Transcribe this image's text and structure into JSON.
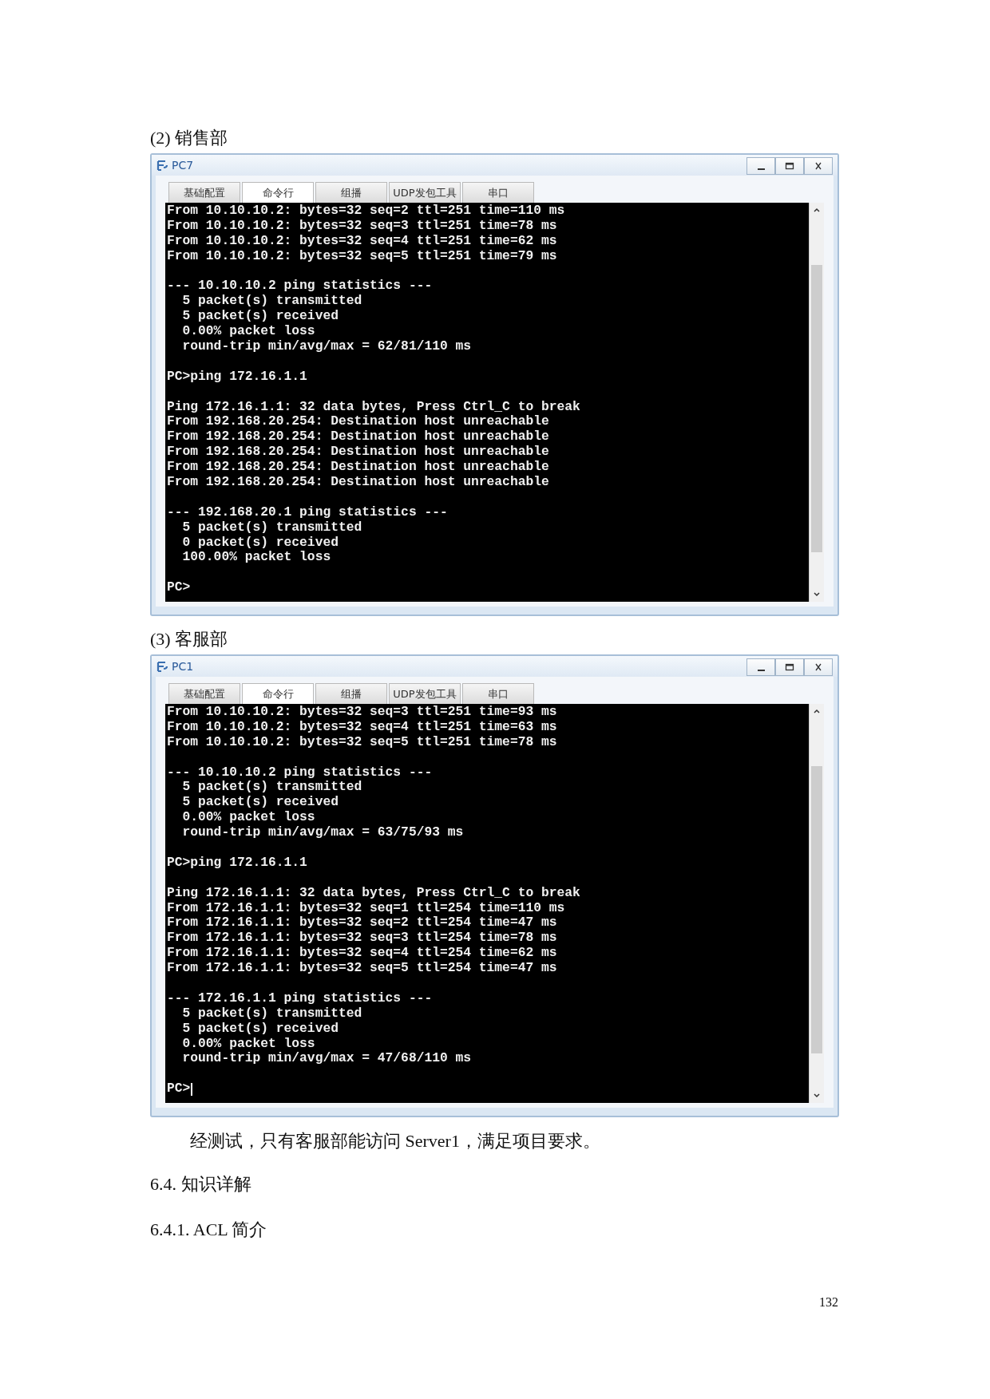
{
  "sections": [
    {
      "heading": "(2) 销售部",
      "window": {
        "title": "PC7",
        "tabs": [
          {
            "label": "基础配置",
            "selected": false
          },
          {
            "label": "命令行",
            "selected": true
          },
          {
            "label": "组播",
            "selected": false
          },
          {
            "label": "UDP发包工具",
            "selected": false
          },
          {
            "label": "串口",
            "selected": false
          }
        ],
        "terminal": {
          "cursor": false,
          "blocks": [
            [
              "From 10.10.10.2: bytes=32 seq=2 ttl=251 time=110 ms",
              "From 10.10.10.2: bytes=32 seq=3 ttl=251 time=78 ms",
              "From 10.10.10.2: bytes=32 seq=4 ttl=251 time=62 ms",
              "From 10.10.10.2: bytes=32 seq=5 ttl=251 time=79 ms"
            ],
            [
              "--- 10.10.10.2 ping statistics ---",
              "  5 packet(s) transmitted",
              "  5 packet(s) received",
              "  0.00% packet loss",
              "  round-trip min/avg/max = 62/81/110 ms"
            ],
            [
              "PC>ping 172.16.1.1"
            ],
            [
              "Ping 172.16.1.1: 32 data bytes, Press Ctrl_C to break",
              "From 192.168.20.254: Destination host unreachable",
              "From 192.168.20.254: Destination host unreachable",
              "From 192.168.20.254: Destination host unreachable",
              "From 192.168.20.254: Destination host unreachable",
              "From 192.168.20.254: Destination host unreachable"
            ],
            [
              "--- 192.168.20.1 ping statistics ---",
              "  5 packet(s) transmitted",
              "  0 packet(s) received",
              "  100.00% packet loss"
            ],
            [
              "PC>"
            ]
          ]
        }
      }
    },
    {
      "heading": "(3) 客服部",
      "window": {
        "title": "PC1",
        "tabs": [
          {
            "label": "基础配置",
            "selected": false
          },
          {
            "label": "命令行",
            "selected": true
          },
          {
            "label": "组播",
            "selected": false
          },
          {
            "label": "UDP发包工具",
            "selected": false
          },
          {
            "label": "串口",
            "selected": false
          }
        ],
        "terminal": {
          "cursor": true,
          "blocks": [
            [
              "From 10.10.10.2: bytes=32 seq=3 ttl=251 time=93 ms",
              "From 10.10.10.2: bytes=32 seq=4 ttl=251 time=63 ms",
              "From 10.10.10.2: bytes=32 seq=5 ttl=251 time=78 ms"
            ],
            [
              "--- 10.10.10.2 ping statistics ---",
              "  5 packet(s) transmitted",
              "  5 packet(s) received",
              "  0.00% packet loss",
              "  round-trip min/avg/max = 63/75/93 ms"
            ],
            [
              "PC>ping 172.16.1.1"
            ],
            [
              "Ping 172.16.1.1: 32 data bytes, Press Ctrl_C to break",
              "From 172.16.1.1: bytes=32 seq=1 ttl=254 time=110 ms",
              "From 172.16.1.1: bytes=32 seq=2 ttl=254 time=47 ms",
              "From 172.16.1.1: bytes=32 seq=3 ttl=254 time=78 ms",
              "From 172.16.1.1: bytes=32 seq=4 ttl=254 time=62 ms",
              "From 172.16.1.1: bytes=32 seq=5 ttl=254 time=47 ms"
            ],
            [
              "--- 172.16.1.1 ping statistics ---",
              "  5 packet(s) transmitted",
              "  5 packet(s) received",
              "  0.00% packet loss",
              "  round-trip min/avg/max = 47/68/110 ms"
            ],
            [
              "PC>"
            ]
          ]
        }
      }
    }
  ],
  "paragraph": "经测试，只有客服部能访问 Server1，满足项目要求。",
  "headings": [
    "6.4. 知识详解",
    "6.4.1. ACL 简介"
  ],
  "page_number": "132"
}
